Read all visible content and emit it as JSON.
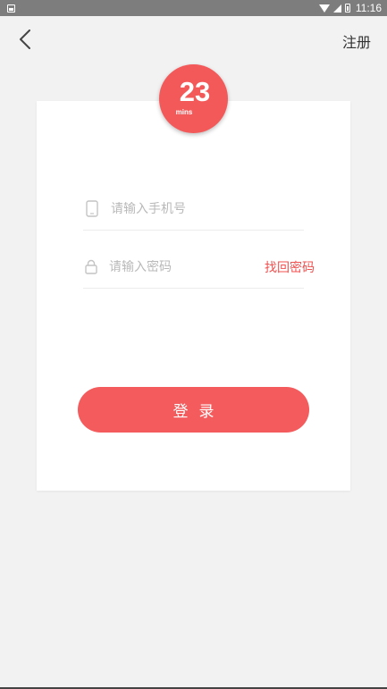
{
  "status_bar": {
    "time": "11:16",
    "icons": [
      "notification-icon",
      "wifi-icon",
      "signal-icon",
      "battery-icon"
    ]
  },
  "header": {
    "back_icon": "chevron-left-icon",
    "register_label": "注册"
  },
  "logo": {
    "text_main": "23",
    "text_sub": "mins",
    "color": "#f4595a"
  },
  "form": {
    "phone": {
      "placeholder": "请输入手机号",
      "value": "",
      "icon": "phone-icon"
    },
    "password": {
      "placeholder": "请输入密码",
      "value": "",
      "icon": "lock-icon"
    },
    "forgot_label": "找回密码",
    "login_label": "登录"
  },
  "colors": {
    "accent": "#f35b5c",
    "background": "#f2f2f2",
    "card": "#ffffff"
  }
}
